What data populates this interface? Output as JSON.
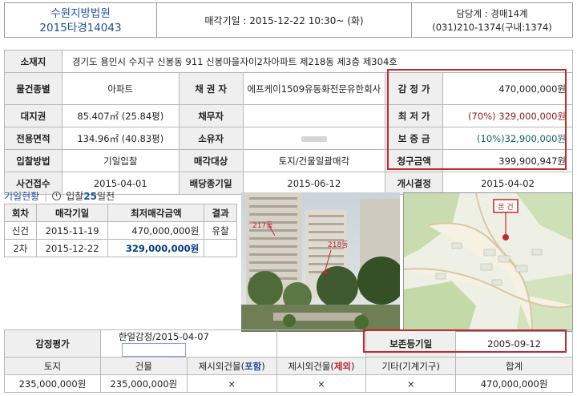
{
  "header": {
    "court": "수원지방법원",
    "case_no": "2015타경14043",
    "sale_date": "매각기일 : 2015-12-22   10:30~ (화)",
    "charge": "담당계 : 경매14계",
    "phone": "(031)210-1374(구내:1374)"
  },
  "property": {
    "address_label": "소재지",
    "address": "경기도 용인시 수지구 신봉동 911 신봉마을자이2차아파트 제218동 제3층 제304호",
    "type_label": "물건종별",
    "type": "아파트",
    "creditor_label": "채 권 자",
    "creditor": "에프케이1509유동화전문유한회사",
    "appraisal_label": "감 정 가",
    "appraisal": "470,000,000원",
    "land_right_label": "대지권",
    "land_right": "85.407㎡ (25.84평)",
    "debtor_label": "채무자",
    "min_price_label": "최 저 가",
    "min_price_pct": "(70%)",
    "min_price": "329,000,000원",
    "area_label": "전용면적",
    "area": "134.96㎡ (40.83평)",
    "owner_label": "소유자",
    "deposit_label": "보 증 금",
    "deposit": "(10%)32,900,000원",
    "bid_method_label": "입찰방법",
    "bid_method": "기일입찰",
    "sale_target_label": "매각대상",
    "sale_target": "토지/건물일괄매각",
    "claim_label": "청구금액",
    "claim": "399,900,947원",
    "case_received_label": "사건접수",
    "case_received": "2015-04-01",
    "dividend_label": "배당종기일",
    "dividend": "2015-06-12",
    "start_decision_label": "개시결정",
    "start_decision": "2015-04-02"
  },
  "history": {
    "title": "기일현황",
    "bid_prefix": "입찰",
    "bid_days": "25",
    "bid_suffix": "일전",
    "columns": [
      "회차",
      "매각기일",
      "최저매각금액",
      "결과"
    ],
    "rows": [
      {
        "round": "신건",
        "date": "2015-11-19",
        "price": "470,000,000원",
        "result": "유찰"
      },
      {
        "round": "2차",
        "date": "2015-12-22",
        "price": "329,000,000원",
        "result": ""
      }
    ]
  },
  "photo": {
    "label_a": "217동",
    "label_b": "218동"
  },
  "map": {
    "marker": "본 건"
  },
  "valuation": {
    "label": "감정평가",
    "value": "한얼감정/2015-04-07",
    "preserve_label": "보존등기일",
    "preserve_date": "2005-09-12",
    "col_land": "토지",
    "col_building": "건물",
    "col_excl_include_pre": "제시외건물(",
    "col_excl_include_word": "포함",
    "col_excl_include_post": ")",
    "col_excl_exclude_pre": "제시외건물(",
    "col_excl_exclude_word": "제외",
    "col_excl_exclude_post": ")",
    "col_other": "기타(기계기구)",
    "col_total": "합계",
    "land": "235,000,000원",
    "building": "235,000,000원",
    "excl_include": "×",
    "excl_exclude": "×",
    "other": "×",
    "total": "470,000,000원"
  },
  "colors": {
    "accent_blue": "#1f4e9a",
    "highlight_red": "#c0282e"
  }
}
